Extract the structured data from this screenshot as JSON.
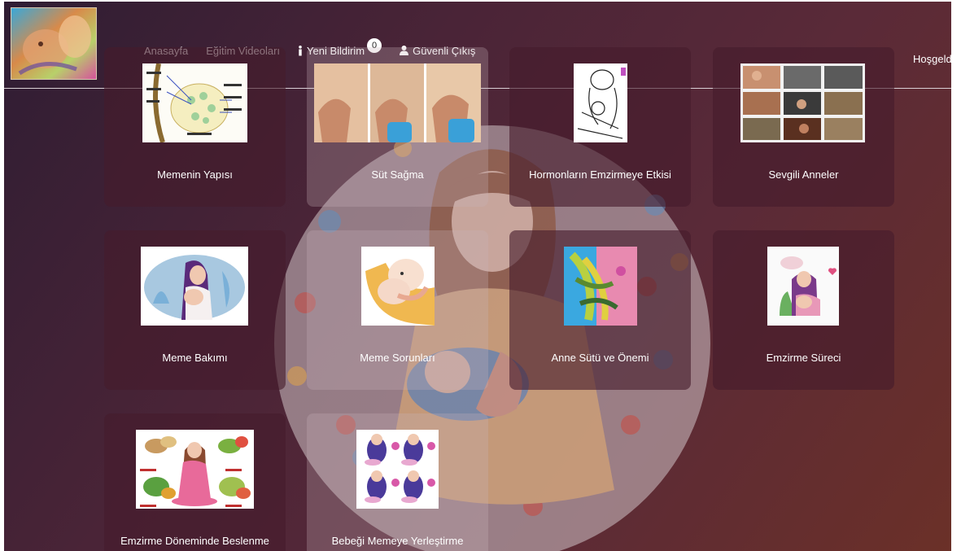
{
  "nav": {
    "home": "Anasayfa",
    "videos": "Eğitim Videoları",
    "notifications": "Yeni Bildirim",
    "notification_count": "0",
    "logout": "Güvenli Çıkış",
    "welcome": "Hoşgeld"
  },
  "cards": [
    {
      "title": "Memenin Yapısı"
    },
    {
      "title": "Süt Sağma"
    },
    {
      "title": "Hormonların Emzirmeye Etkisi"
    },
    {
      "title": "Sevgili Anneler"
    },
    {
      "title": "Meme Bakımı"
    },
    {
      "title": "Meme Sorunları"
    },
    {
      "title": "Anne Sütü ve Önemi"
    },
    {
      "title": "Emzirme Süreci"
    },
    {
      "title": "Emzirme Döneminde Beslenme"
    },
    {
      "title": "Bebeği Memeye Yerleştirme"
    }
  ],
  "colors": {
    "background_start": "#2f1d33",
    "background_end": "#6b3028",
    "card": "#461c2c",
    "text": "#ffffff"
  }
}
